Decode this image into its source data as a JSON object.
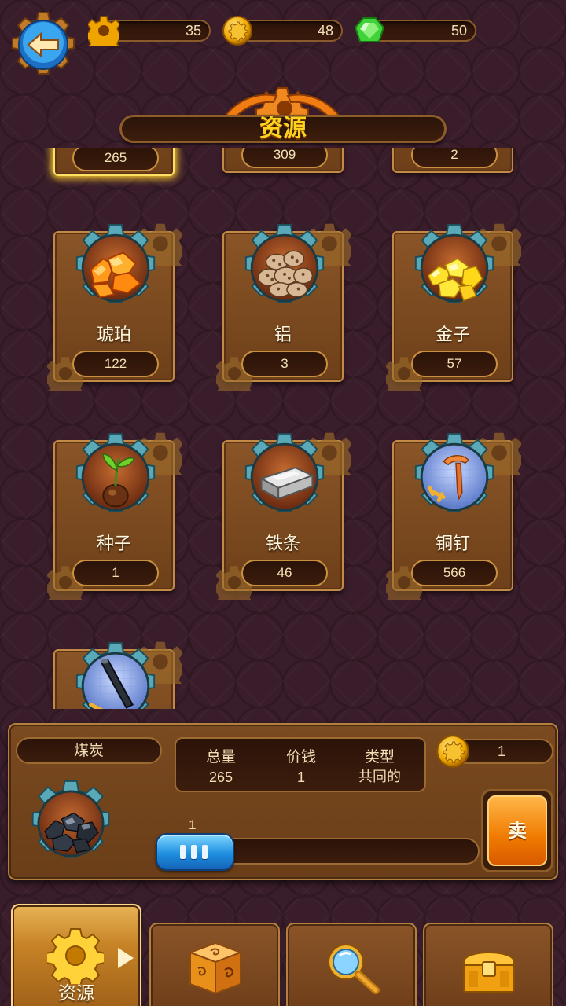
{
  "header": {
    "title": "资源",
    "back_icon": "back-arrow-icon",
    "currencies": [
      {
        "name": "gears",
        "icon": "gear-icon",
        "value": "35"
      },
      {
        "name": "coins",
        "icon": "coin-icon",
        "value": "48"
      },
      {
        "name": "gems",
        "icon": "green-gem-icon",
        "value": "50"
      }
    ]
  },
  "resources": [
    {
      "name": "",
      "count": "265",
      "icon": "coal-icon",
      "selected": true
    },
    {
      "name": "",
      "count": "309",
      "icon": "unknown-icon"
    },
    {
      "name": "",
      "count": "2",
      "icon": "unknown-icon"
    },
    {
      "name": "琥珀",
      "count": "122",
      "icon": "amber-icon"
    },
    {
      "name": "铝",
      "count": "3",
      "icon": "aluminum-ore-icon"
    },
    {
      "name": "金子",
      "count": "57",
      "icon": "gold-nuggets-icon"
    },
    {
      "name": "种子",
      "count": "1",
      "icon": "seed-sprout-icon"
    },
    {
      "name": "铁条",
      "count": "46",
      "icon": "iron-bar-icon"
    },
    {
      "name": "铜钉",
      "count": "566",
      "icon": "copper-nail-icon"
    },
    {
      "name": "",
      "count": "",
      "icon": "pipe-blueprint-icon"
    }
  ],
  "detail": {
    "selected_name": "煤炭",
    "total_label": "总量",
    "total_value": "265",
    "price_label": "价钱",
    "price_value": "1",
    "type_label": "类型",
    "type_value": "共同的",
    "sell_price": "1",
    "slider_value": "1",
    "sell_label": "卖"
  },
  "tabs": [
    {
      "label": "资源",
      "icon": "gear-icon",
      "active": true
    },
    {
      "label": "",
      "icon": "dice-icon"
    },
    {
      "label": "",
      "icon": "magnifier-icon"
    },
    {
      "label": "",
      "icon": "treasure-chest-icon"
    }
  ],
  "colors": {
    "background": "#3a1d2b",
    "panel": "#7a4a20",
    "title_text": "#ffd21e",
    "accent_blue": "#1f8fe0",
    "sell_orange": "#f07a00"
  }
}
